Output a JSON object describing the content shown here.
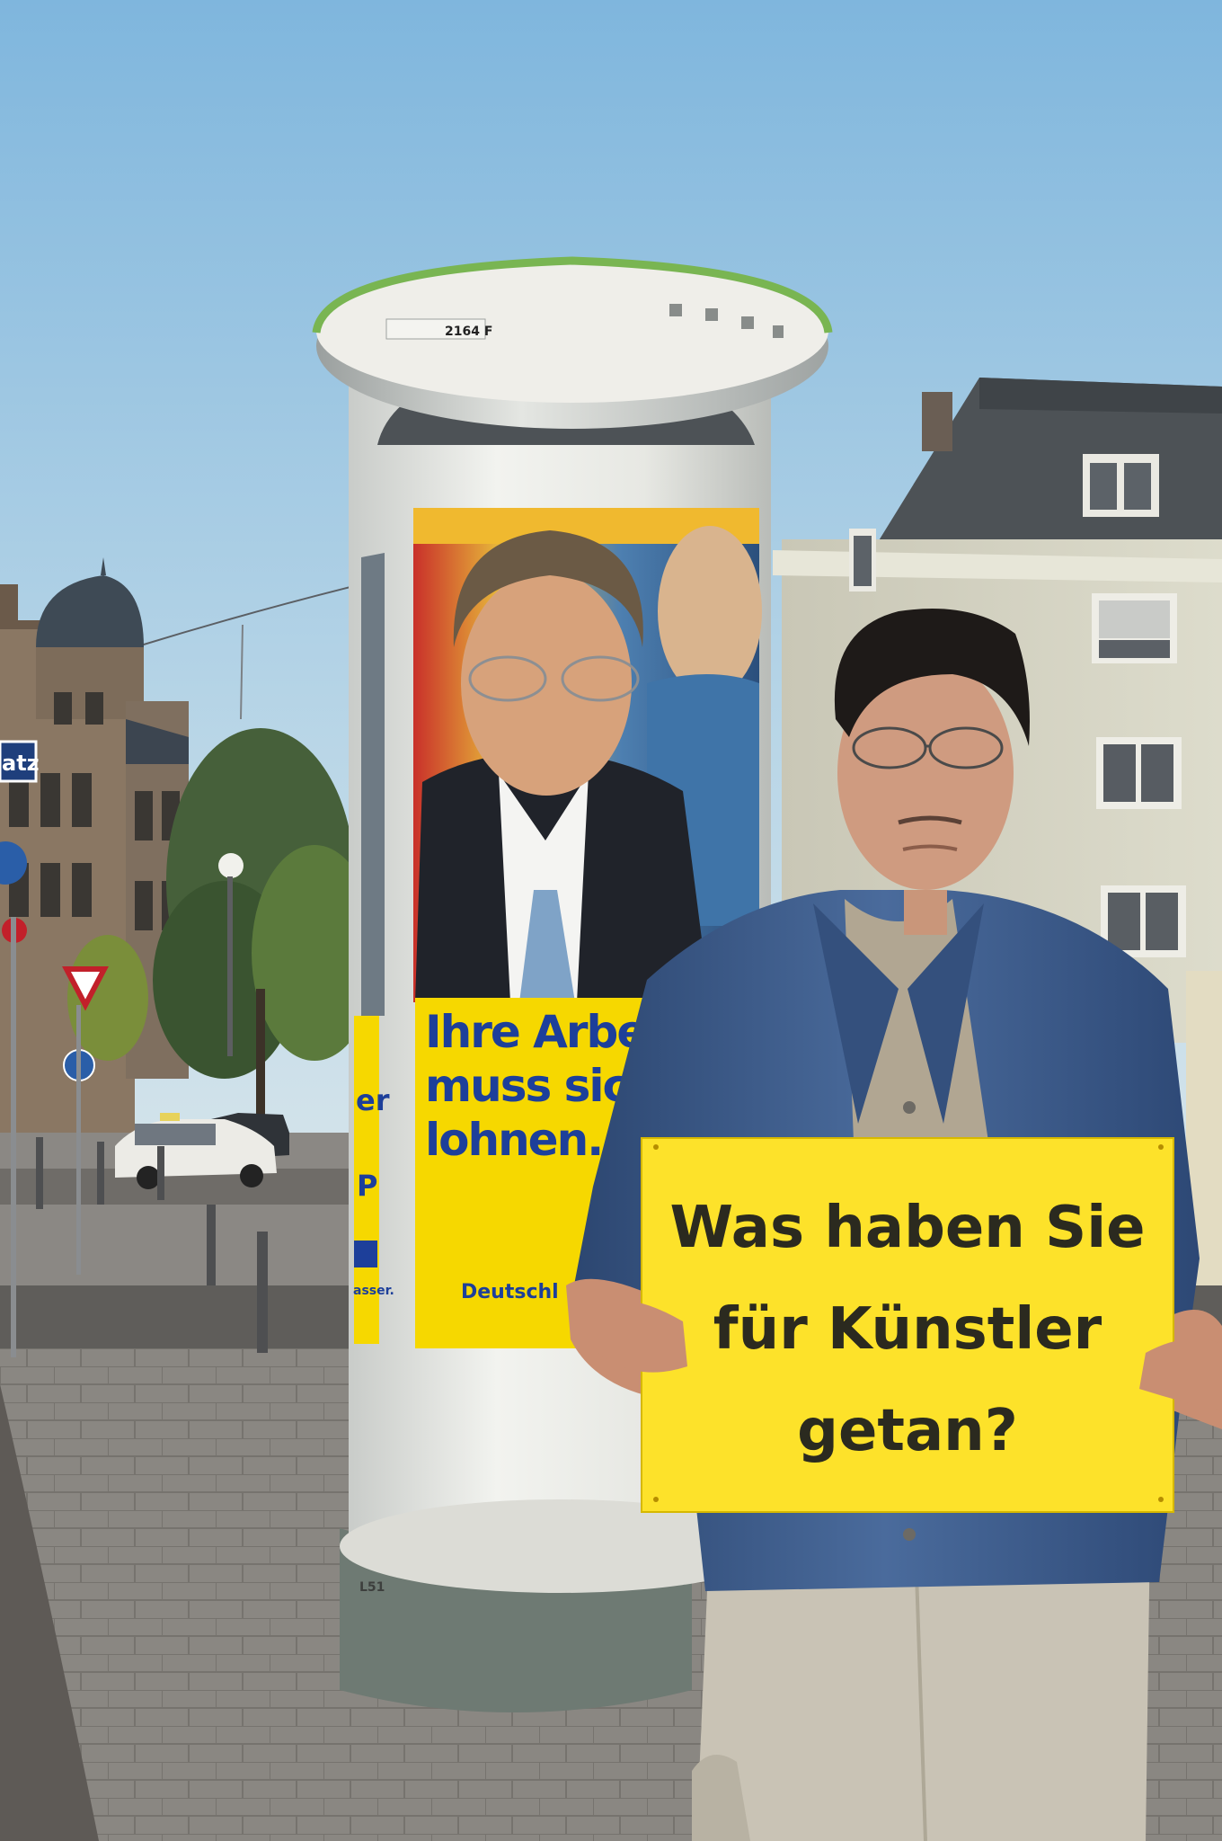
{
  "column": {
    "id_label": "2164 F",
    "base_mark": "L51"
  },
  "poster": {
    "slogan_lines": [
      "Ihre Arbeit",
      "muss sich",
      "lohnen."
    ],
    "footer_text": "Deutschl",
    "left_fragment_top": "er",
    "left_fragment_mid": "P",
    "left_fragment_bottom": "asser."
  },
  "sign": {
    "lines": [
      "Was haben Sie",
      "für Künstler",
      "getan?"
    ]
  },
  "street_sign": {
    "text": "atz"
  },
  "colors": {
    "sky_top": "#7fb6dd",
    "sky_bottom": "#d8e7ee",
    "poster_yellow": "#f6d800",
    "poster_blue": "#1d3f9a",
    "sign_yellow": "#fde22a",
    "denim": "#3f5f8f"
  }
}
